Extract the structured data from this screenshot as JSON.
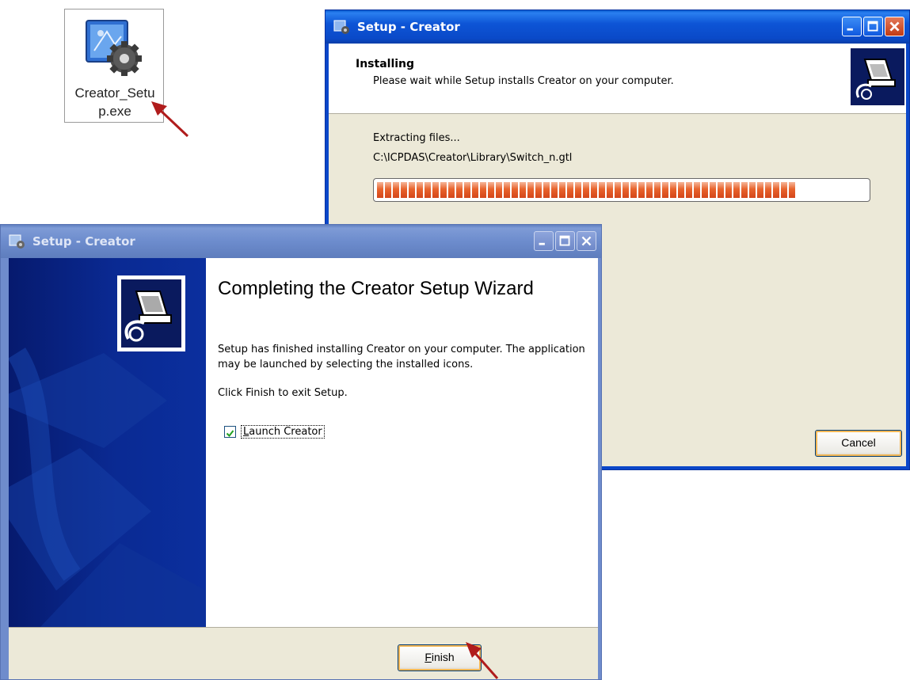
{
  "desktop_icon": {
    "label": "Creator_Setup.exe"
  },
  "installing_window": {
    "title": "Setup - Creator",
    "header_title": "Installing",
    "header_subtitle": "Please wait while Setup installs Creator on your computer.",
    "status_text": "Extracting files...",
    "current_file": "C:\\ICPDAS\\Creator\\Library\\Switch_n.gtl",
    "progress_fraction": 0.86,
    "cancel_label": "Cancel"
  },
  "complete_window": {
    "title": "Setup - Creator",
    "heading": "Completing the Creator Setup Wizard",
    "message": "Setup has finished installing Creator on your computer. The application may be launched by selecting the installed icons.",
    "exit_hint": "Click Finish to exit Setup.",
    "launch_checkbox": {
      "label": "Launch Creator",
      "checked": true
    },
    "finish_label": "Finish"
  },
  "colors": {
    "active_titlebar": "#0a49c8",
    "inactive_titlebar": "#6d8ccd",
    "progress_fill": "#e8632c",
    "banner": "#0a2a93",
    "annotation_arrow": "#b01c1c"
  }
}
